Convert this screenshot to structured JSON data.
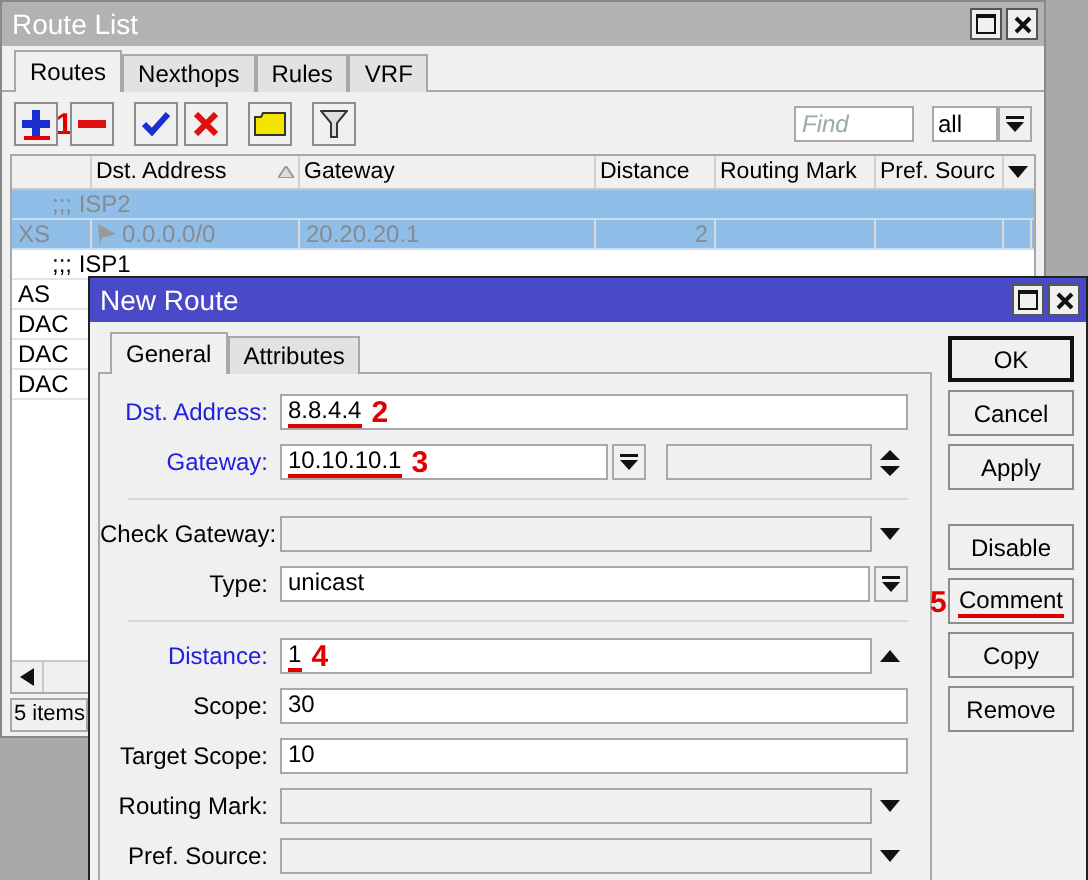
{
  "route_list": {
    "title": "Route List",
    "tabs": [
      {
        "label": "Routes",
        "selected": true
      },
      {
        "label": "Nexthops",
        "selected": false
      },
      {
        "label": "Rules",
        "selected": false
      },
      {
        "label": "VRF",
        "selected": false
      }
    ],
    "toolbar": {
      "add_annotation": "1",
      "find_placeholder": "Find",
      "filter_value": "all"
    },
    "columns": [
      "Dst. Address",
      "Gateway",
      "Distance",
      "Routing Mark",
      "Pref. Sourc"
    ],
    "rows": [
      {
        "kind": "comment",
        "text": ";;; ISP2",
        "selected": true,
        "disabled": true
      },
      {
        "kind": "route",
        "flags": "XS",
        "dst": "0.0.0.0/0",
        "gateway": "20.20.20.1",
        "distance": "2",
        "selected": true,
        "disabled": true
      },
      {
        "kind": "comment",
        "text": ";;; ISP1",
        "selected": false,
        "disabled": false
      },
      {
        "kind": "route",
        "flags": "AS",
        "selected": false,
        "disabled": false
      },
      {
        "kind": "route",
        "flags": "DAC",
        "selected": false,
        "disabled": false
      },
      {
        "kind": "route",
        "flags": "DAC",
        "selected": false,
        "disabled": false
      },
      {
        "kind": "route",
        "flags": "DAC",
        "selected": false,
        "disabled": false
      }
    ],
    "status": "5 items"
  },
  "new_route": {
    "title": "New Route",
    "tabs": [
      {
        "label": "General",
        "selected": true
      },
      {
        "label": "Attributes",
        "selected": false
      }
    ],
    "sections": [
      [
        {
          "kind": "text",
          "label": "Dst. Address:",
          "value": "8.8.4.4",
          "required": true,
          "annotation": "2"
        },
        {
          "kind": "gateway",
          "label": "Gateway:",
          "value": "10.10.10.1",
          "required": true,
          "annotation": "3"
        }
      ],
      [
        {
          "kind": "select",
          "label": "Check Gateway:",
          "required": false
        },
        {
          "kind": "combo",
          "label": "Type:",
          "value": "unicast",
          "required": false
        }
      ],
      [
        {
          "kind": "spin",
          "label": "Distance:",
          "value": "1",
          "required": true,
          "annotation": "4"
        },
        {
          "kind": "text",
          "label": "Scope:",
          "value": "30",
          "required": false
        },
        {
          "kind": "text",
          "label": "Target Scope:",
          "value": "10",
          "required": false
        },
        {
          "kind": "select",
          "label": "Routing Mark:",
          "required": false
        },
        {
          "kind": "select",
          "label": "Pref. Source:",
          "required": false
        }
      ]
    ],
    "buttons": [
      {
        "label": "OK",
        "default": true
      },
      {
        "label": "Cancel",
        "default": false
      },
      {
        "label": "Apply",
        "default": false
      }
    ],
    "actions": [
      {
        "label": "Disable"
      },
      {
        "label": "Comment",
        "annotation": "5"
      },
      {
        "label": "Copy"
      },
      {
        "label": "Remove"
      }
    ]
  }
}
